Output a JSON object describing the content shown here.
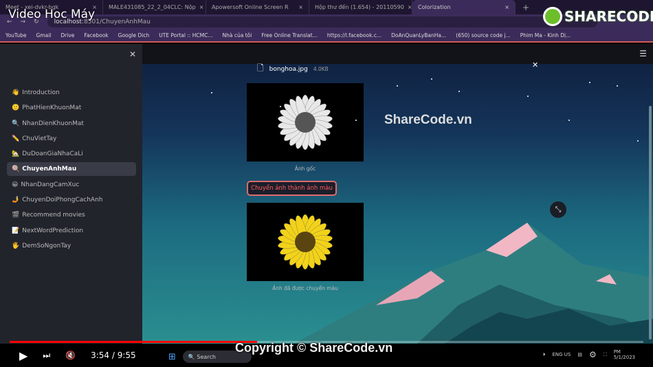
{
  "video": {
    "title": "Video Hoc Máy",
    "current_time": "3:54",
    "duration": "9:55",
    "progress": 0.39
  },
  "browser": {
    "tabs": [
      {
        "label": "Meet - xei-dvkr-bgk"
      },
      {
        "label": "MALE431085_22_2_04CLC: Nộp"
      },
      {
        "label": "Apowersoft Online Screen R"
      },
      {
        "label": "Hộp thư đến (1.654) - 20110590"
      },
      {
        "label": "Colorization",
        "active": true
      }
    ],
    "url_host": "localhost",
    "url_path": ":8501/ChuyenAnhMau",
    "bookmarks": [
      "YouTube",
      "Gmail",
      "Drive",
      "Facebook",
      "Google Dich",
      "UTE Portal :: HCMC...",
      "Nhà của tôi",
      "Free Online Translat...",
      "https://l.facebook.c...",
      "DoAnQuanLyBanHa...",
      "(650) source code j...",
      "Phim Ma - Kinh Dị..."
    ]
  },
  "watermark": {
    "logo": "SHARECODE.vn",
    "center": "ShareCode.vn",
    "copyright": "Copyright © ShareCode.vn"
  },
  "sidebar": {
    "items": [
      {
        "icon": "👋",
        "label": "Introduction"
      },
      {
        "icon": "🙂",
        "label": "PhatHienKhuonMat"
      },
      {
        "icon": "🔍",
        "label": "NhanDienKhuonMat"
      },
      {
        "icon": "✏️",
        "label": "ChuVietTay"
      },
      {
        "icon": "🏡",
        "label": "DuDoanGiaNhaCaLi"
      },
      {
        "icon": "🍭",
        "label": "ChuyenAnhMau",
        "active": true
      },
      {
        "icon": "😀",
        "label": "NhanDangCamXuc"
      },
      {
        "icon": "🤳",
        "label": "ChuyenDoiPhongCachAnh"
      },
      {
        "icon": "🎬",
        "label": "Recommend movies"
      },
      {
        "icon": "📝",
        "label": "NextWordPrediction"
      },
      {
        "icon": "🖐",
        "label": "DemSoNgonTay"
      }
    ]
  },
  "main": {
    "file_name": "bonghoa.jpg",
    "file_size": "4.0KB",
    "original_caption": "Ảnh gốc",
    "convert_button": "Chuyển ảnh thành ảnh màu",
    "result_caption": "Ảnh đã được chuyển màu",
    "colors": {
      "petal_gray": "#e8e8e8",
      "petal_yellow": "#f2d21a",
      "accent": "#ff4b4b"
    }
  },
  "taskbar": {
    "search": "Search",
    "lang": "ENG US",
    "time": "PM",
    "date": "5/1/2023"
  }
}
